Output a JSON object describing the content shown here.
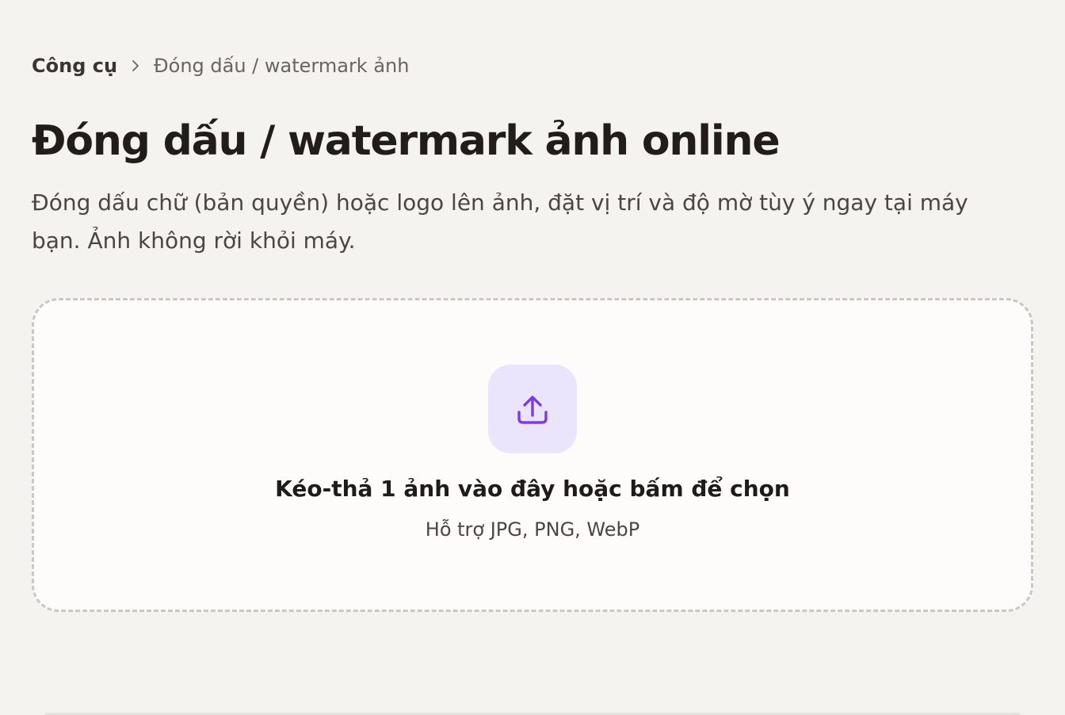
{
  "breadcrumb": {
    "home": "Công cụ",
    "separator_icon": "chevron-right-icon",
    "current": "Đóng dấu / watermark ảnh"
  },
  "page": {
    "title": "Đóng dấu / watermark ảnh online",
    "description": "Đóng dấu chữ (bản quyền) hoặc logo lên ảnh, đặt vị trí và độ mờ tùy ý ngay tại máy bạn. Ảnh không rời khỏi máy."
  },
  "dropzone": {
    "icon": "upload-icon",
    "title": "Kéo-thả 1 ảnh vào đây hoặc bấm để chọn",
    "subtitle": "Hỗ trợ JPG, PNG, WebP"
  },
  "colors": {
    "background": "#f4f3f0",
    "dropzone_bg": "#fdfcfa",
    "dropzone_border": "#cbc8c3",
    "accent": "#7c3aed",
    "accent_tint": "#ebe4fd",
    "text_primary": "#221d19",
    "text_secondary": "#4c4641"
  }
}
